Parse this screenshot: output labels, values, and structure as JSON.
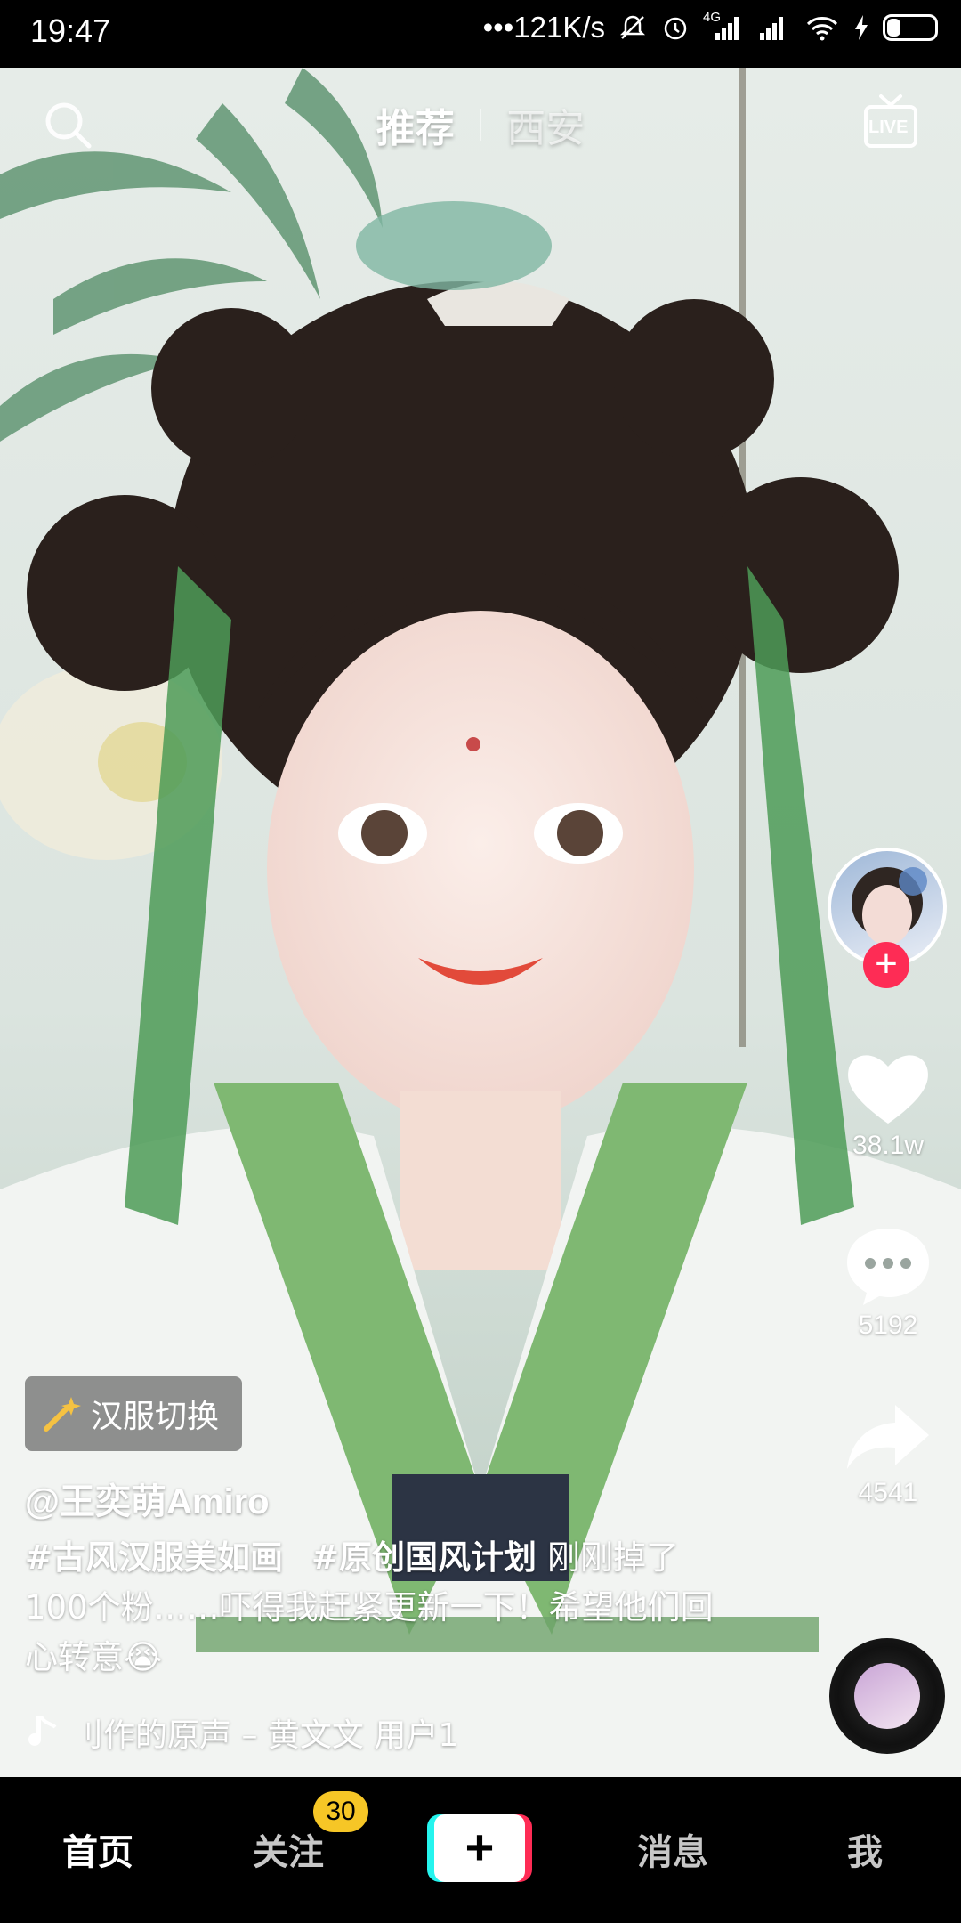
{
  "status_bar": {
    "time": "19:47",
    "network_speed": "•••121K/s",
    "network_type": "4G",
    "battery": "29",
    "battery_level": 0.29,
    "icons": [
      "mute-icon",
      "alarm-icon",
      "signal-4g-icon",
      "signal-icon",
      "wifi-icon",
      "charging-icon",
      "battery-icon"
    ]
  },
  "top_bar": {
    "tabs": [
      {
        "label": "推荐",
        "active": true
      },
      {
        "label": "西安",
        "active": false
      }
    ],
    "live_label": "LIVE"
  },
  "actions": {
    "likes": "38.1w",
    "comments": "5192",
    "shares": "4541",
    "follow_symbol": "+"
  },
  "post": {
    "effect_label": "汉服切换",
    "username": "@王奕萌Amiro",
    "hashtags": [
      "#古风汉服美如画",
      "#原创国风计划"
    ],
    "caption": "刚刚掉了100个粉……吓得我赶紧更新一下！希望他们回心转意😭",
    "music": "刂作的原声 – 黄文文    用户1"
  },
  "bottom_nav": {
    "items": [
      {
        "label": "首页",
        "active": true
      },
      {
        "label": "关注",
        "active": false
      },
      {
        "label": "消息",
        "active": false
      },
      {
        "label": "我",
        "active": false
      }
    ],
    "follow_badge": "30",
    "create_symbol": "+"
  },
  "colors": {
    "accent_red": "#fe2c55",
    "accent_cyan": "#25f4ee",
    "badge_yellow": "#f6c626"
  }
}
